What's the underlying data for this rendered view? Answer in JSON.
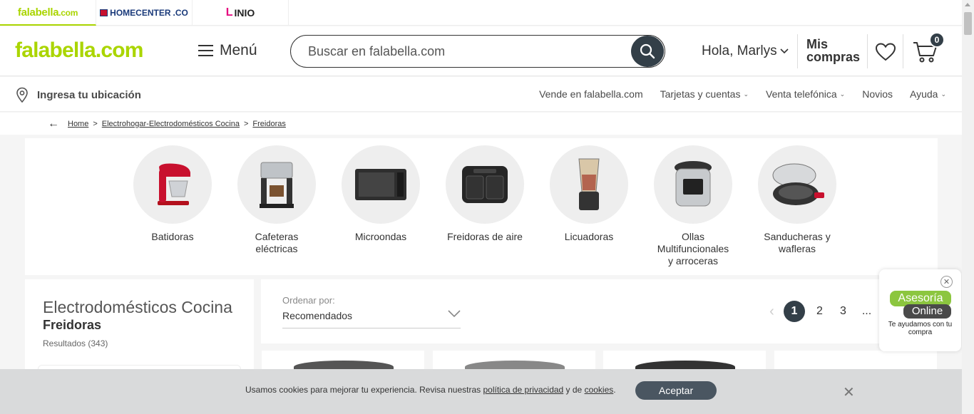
{
  "brands": {
    "falabella": {
      "name": "falabella",
      "suffix": ".com"
    },
    "homecenter": {
      "name": "HOMECENTER",
      "suffix": ".CO"
    },
    "linio": {
      "initial": "L",
      "rest": "INIO"
    }
  },
  "header": {
    "logo": "falabella.com",
    "menu_label": "Menú",
    "search_placeholder": "Buscar en falabella.com",
    "greeting": "Hola, Marlys",
    "mis_line1": "Mis",
    "mis_line2": "compras",
    "cart_count": "0"
  },
  "subnav": {
    "location": "Ingresa tu ubicación",
    "links": [
      "Vende en falabella.com",
      "Tarjetas y cuentas",
      "Venta telefónica",
      "Novios",
      "Ayuda"
    ]
  },
  "breadcrumb": {
    "items": [
      "Home",
      "Electrohogar-Electrodomésticos Cocina",
      "Freidoras"
    ],
    "separator": ">"
  },
  "categories": [
    {
      "line1": "Batidoras",
      "line2": "",
      "line3": ""
    },
    {
      "line1": "Cafeteras",
      "line2": "eléctricas",
      "line3": ""
    },
    {
      "line1": "Microondas",
      "line2": "",
      "line3": ""
    },
    {
      "line1": "Freidoras de aire",
      "line2": "",
      "line3": ""
    },
    {
      "line1": "Licuadoras",
      "line2": "",
      "line3": ""
    },
    {
      "line1": "Ollas",
      "line2": "Multifuncionales",
      "line3": "y arroceras"
    },
    {
      "line1": "Sanducheras y",
      "line2": "wafleras",
      "line3": ""
    }
  ],
  "sidebar": {
    "title": "Electrodomésticos Cocina",
    "subtitle": "Freidoras",
    "results": "Resultados (343)"
  },
  "sort": {
    "label": "Ordenar por:",
    "value": "Recomendados"
  },
  "pagination": {
    "current": "1",
    "pages": [
      "2",
      "3"
    ],
    "ellipsis": "..."
  },
  "cookies": {
    "text_before": "Usamos cookies para mejorar tu experiencia. Revisa nuestras ",
    "link1": "política de privacidad",
    "text_mid": " y de ",
    "link2": "cookies",
    "text_after": ".",
    "accept": "Aceptar"
  },
  "chat": {
    "line1": "Asesoría",
    "line2": "Online",
    "caption": "Te ayudamos con tu compra"
  },
  "colors": {
    "brand_green": "#aad500",
    "dark": "#333f48",
    "linio_pink": "#e5007e",
    "chat_green": "#8cc63f"
  }
}
